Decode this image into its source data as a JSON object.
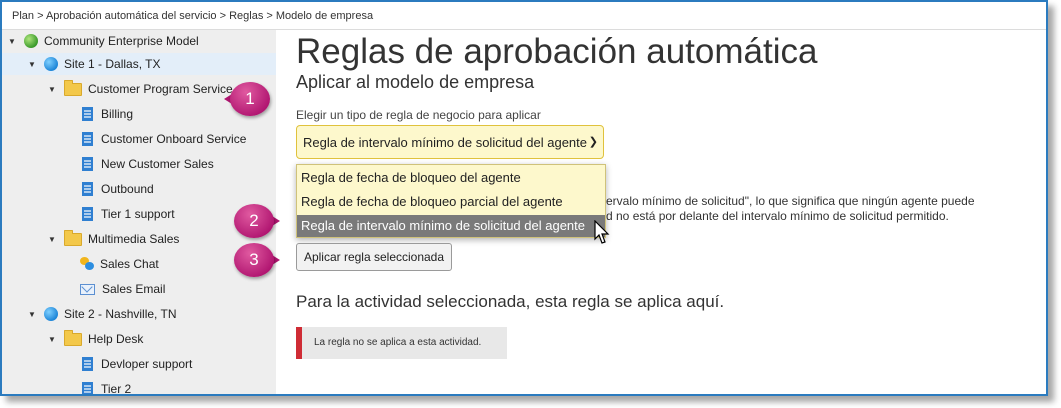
{
  "breadcrumb": "Plan > Aprobación automática del servicio > Reglas > Modelo de empresa",
  "tree": [
    {
      "label": "Community Enterprise Model",
      "icon": "globe-green-icon",
      "caret": "expanded"
    },
    {
      "label": "Site 1 - Dallas, TX",
      "icon": "globe-icon",
      "caret": "expanded"
    },
    {
      "label": "Customer Program Service",
      "icon": "folder-icon",
      "caret": "expanded"
    },
    {
      "label": "Billing",
      "icon": "queue-icon"
    },
    {
      "label": "Customer Onboard Service",
      "icon": "queue-icon"
    },
    {
      "label": "New Customer Sales",
      "icon": "queue-icon"
    },
    {
      "label": "Outbound",
      "icon": "queue-icon"
    },
    {
      "label": "Tier 1 support",
      "icon": "queue-icon"
    },
    {
      "label": "Multimedia Sales",
      "icon": "folder-icon",
      "caret": "expanded"
    },
    {
      "label": "Sales Chat",
      "icon": "chat-icon"
    },
    {
      "label": "Sales Email",
      "icon": "email-icon"
    },
    {
      "label": "Site 2 - Nashville, TN",
      "icon": "globe-icon",
      "caret": "expanded"
    },
    {
      "label": "Help Desk",
      "icon": "folder-icon",
      "caret": "expanded"
    },
    {
      "label": "Devloper support",
      "icon": "queue-icon"
    },
    {
      "label": "Tier 2",
      "icon": "queue-icon"
    }
  ],
  "main": {
    "title": "Reglas de aprobación automática",
    "subtitle": "Aplicar al modelo de empresa",
    "select_label": "Elegir un tipo de regla de negocio para aplicar",
    "select_value": "Regla de intervalo mínimo de solicitud del agente",
    "options": [
      "Regla de fecha de bloqueo del agente",
      "Regla de fecha de bloqueo parcial del agente",
      "Regla de intervalo mínimo de solicitud del agente"
    ],
    "highlighted_option": 2,
    "description_line1": "ervalo mínimo de solicitud\", lo que significa que ningún agente puede",
    "description_line2": "d no está por delante del intervalo mínimo de solicitud permitido.",
    "apply_button": "Aplicar regla seleccionada",
    "section_heading": "Para la actividad seleccionada, esta regla se aplica aquí.",
    "notice": "La regla no se aplica a esta actividad."
  },
  "callouts": [
    "1",
    "2",
    "3"
  ],
  "colors": {
    "accent_border": "#2b7bbf",
    "callout": "#b01570",
    "select_bg": "#fdf8cc",
    "notice_bar": "#cf2c35"
  }
}
